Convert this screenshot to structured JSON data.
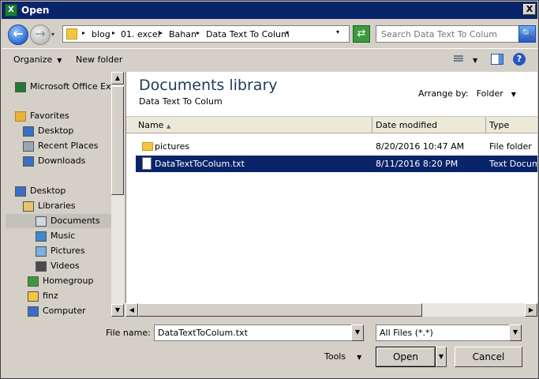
{
  "window": {
    "title": "Open",
    "close_glyph": "X",
    "app_icon_label": "X"
  },
  "nav": {
    "back_glyph": "←",
    "forward_glyph": "→",
    "history_glyph": "▾",
    "breadcrumbs": [
      "blog",
      "01. excel",
      "Bahan",
      "Data Text To Colum"
    ],
    "breadcrumb_sep": "▸",
    "address_drop": "▾",
    "refresh_glyph": "⇄",
    "search_placeholder": "Search Data Text To Colum",
    "search_glyph": "🔍"
  },
  "toolbar": {
    "organize_label": "Organize",
    "dropdown_glyph": "▼",
    "new_folder_label": "New folder",
    "help_glyph": "?"
  },
  "navpane": {
    "items": [
      {
        "label": "Microsoft Office Exc",
        "icon": "excel-icon",
        "color": "#1f7a3a"
      },
      {
        "label": "Favorites",
        "icon": "star-icon",
        "color": "#e8b13a"
      },
      {
        "label": "Desktop",
        "icon": "desktop-icon",
        "color": "#3a6fc4"
      },
      {
        "label": "Recent Places",
        "icon": "recent-places-icon",
        "color": "#9aa6b4"
      },
      {
        "label": "Downloads",
        "icon": "downloads-icon",
        "color": "#3a6fc4"
      },
      {
        "label": "Desktop",
        "icon": "desktop-icon",
        "color": "#3a6fc4"
      },
      {
        "label": "Libraries",
        "icon": "libraries-icon",
        "color": "#e8c46a"
      },
      {
        "label": "Documents",
        "icon": "documents-icon",
        "color": "#cfd8e6"
      },
      {
        "label": "Music",
        "icon": "music-icon",
        "color": "#3a8ad0"
      },
      {
        "label": "Pictures",
        "icon": "pictures-icon",
        "color": "#7ab0e0"
      },
      {
        "label": "Videos",
        "icon": "videos-icon",
        "color": "#4a4a4a"
      },
      {
        "label": "Homegroup",
        "icon": "homegroup-icon",
        "color": "#3a9a3a"
      },
      {
        "label": "finz",
        "icon": "user-folder-icon",
        "color": "#f5c542"
      },
      {
        "label": "Computer",
        "icon": "computer-icon",
        "color": "#3a6fc4"
      }
    ]
  },
  "content": {
    "library_title": "Documents library",
    "library_subtitle": "Data Text To Colum",
    "arrange_label": "Arrange by:",
    "arrange_value": "Folder",
    "arrange_drop": "▼",
    "columns": {
      "name": "Name",
      "sort": "▲",
      "date": "Date modified",
      "type": "Type"
    },
    "files": [
      {
        "name": "pictures",
        "date": "8/20/2016 10:47 AM",
        "type": "File folder",
        "kind": "folder",
        "selected": false
      },
      {
        "name": "DataTextToColum.txt",
        "date": "8/11/2016 8:20 PM",
        "type": "Text Docume",
        "kind": "txt",
        "selected": true
      }
    ]
  },
  "scroll": {
    "up": "▲",
    "down": "▼",
    "left": "◀",
    "right": "▶"
  },
  "bottom": {
    "file_name_label": "File name:",
    "file_name_value": "DataTextToColum.txt",
    "filter_value": "All Files (*.*)",
    "combo_glyph": "▼",
    "tools_label": "Tools",
    "open_label": "Open",
    "cancel_label": "Cancel"
  }
}
